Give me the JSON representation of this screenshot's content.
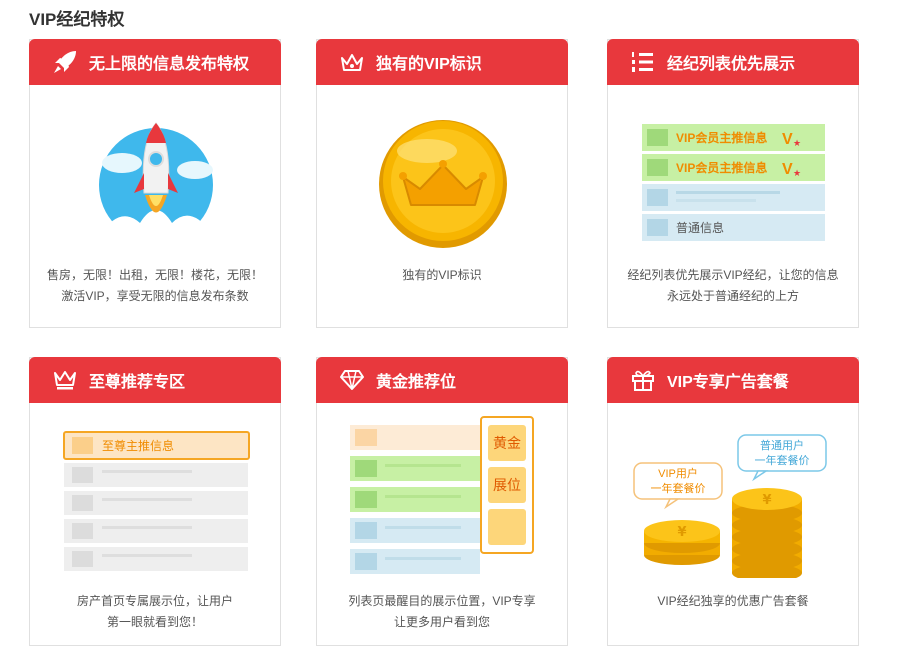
{
  "page": {
    "title": "VIP经纪特权"
  },
  "cards": [
    {
      "title": "无上限的信息发布特权",
      "icon": "rocket-icon",
      "desc_lines": [
        "售房，无限！出租，无限！楼花，无限！",
        "激活VIP，享受无限的信息发布条数"
      ]
    },
    {
      "title": "独有的VIP标识",
      "icon": "crown-icon",
      "desc_lines": [
        "独有的VIP标识"
      ]
    },
    {
      "title": "经纪列表优先展示",
      "icon": "ranked-list-icon",
      "desc_lines": [
        "经纪列表优先展示VIP经纪，让您的信息",
        "永远处于普通经纪的上方"
      ],
      "list_labels": [
        "VIP会员主推信息",
        "VIP会员主推信息",
        "普通信息"
      ]
    },
    {
      "title": "至尊推荐专区",
      "icon": "crown-icon",
      "desc_lines": [
        "房产首页专属展示位，让用户",
        "第一眼就看到您！"
      ],
      "featured_label": "至尊主推信息"
    },
    {
      "title": "黄金推荐位",
      "icon": "diamond-icon",
      "desc_lines": [
        "列表页最醒目的展示位置，VIP专享",
        "让更多用户看到您"
      ],
      "side_labels": [
        "黄金",
        "展位"
      ]
    },
    {
      "title": "VIP专享广告套餐",
      "icon": "gift-icon",
      "desc_lines": [
        "VIP经纪独享的优惠广告套餐"
      ],
      "bubble_vip": [
        "VIP用户",
        "一年套餐价"
      ],
      "bubble_normal": [
        "普通用户",
        "一年套餐价"
      ]
    }
  ],
  "colors": {
    "red": "#e8383d",
    "green": "#c7f0a4",
    "gold": "#f5b400",
    "orange": "#f08c00"
  }
}
